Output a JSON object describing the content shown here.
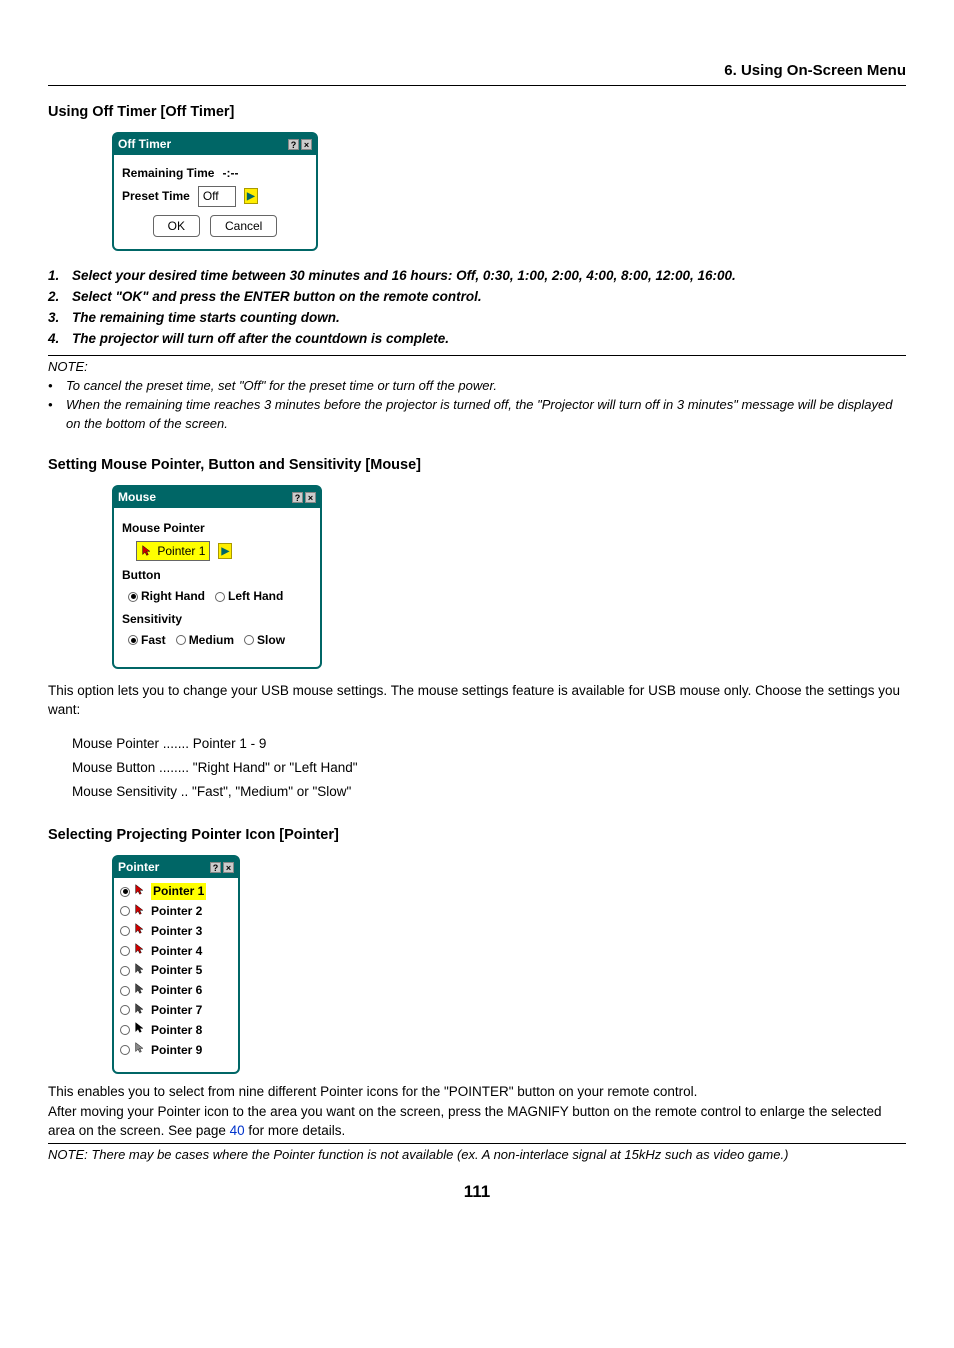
{
  "header": {
    "title": "6. Using On-Screen Menu"
  },
  "offTimer": {
    "sectionTitle": "Using Off Timer [Off Timer]",
    "dialogTitle": "Off Timer",
    "remainingLabel": "Remaining Time",
    "remainingValue": "-:--",
    "presetLabel": "Preset Time",
    "presetValue": "Off",
    "okLabel": "OK",
    "cancelLabel": "Cancel",
    "steps": [
      "Select your desired time between 30 minutes and 16 hours: Off, 0:30, 1:00, 2:00, 4:00, 8:00, 12:00, 16:00.",
      "Select \"OK\" and press the ENTER button on the remote control.",
      "The remaining time starts counting down.",
      "The projector will turn off after the countdown is complete."
    ],
    "noteLabel": "NOTE:",
    "notes": [
      "To cancel the preset time, set \"Off\" for the preset time or turn off the power.",
      "When the remaining time reaches 3 minutes before the projector is turned off, the \"Projector will turn off in 3 minutes\" message will be displayed on the bottom of the screen."
    ]
  },
  "mouse": {
    "sectionTitle": "Setting Mouse Pointer, Button and Sensitivity [Mouse]",
    "dialogTitle": "Mouse",
    "pointerLabel": "Mouse Pointer",
    "pointerValue": "Pointer 1",
    "buttonLabel": "Button",
    "buttonOpts": [
      "Right Hand",
      "Left Hand"
    ],
    "sensLabel": "Sensitivity",
    "sensOpts": [
      "Fast",
      "Medium",
      "Slow"
    ],
    "bodyText": "This option lets you to change your USB mouse settings. The mouse settings feature is available for USB mouse only. Choose the settings you want:",
    "settings": [
      {
        "k": "Mouse Pointer",
        "dots": ".......",
        "v": "Pointer 1 - 9"
      },
      {
        "k": "Mouse Button",
        "dots": "........",
        "v": "\"Right Hand\" or \"Left Hand\""
      },
      {
        "k": "Mouse Sensitivity",
        "dots": "..",
        "v": "\"Fast\", \"Medium\" or \"Slow\""
      }
    ]
  },
  "pointer": {
    "sectionTitle": "Selecting Projecting Pointer Icon [Pointer]",
    "dialogTitle": "Pointer",
    "items": [
      {
        "label": "Pointer 1",
        "selected": true,
        "color": "#cc0000"
      },
      {
        "label": "Pointer 2",
        "selected": false,
        "color": "#cc0000"
      },
      {
        "label": "Pointer 3",
        "selected": false,
        "color": "#cc0000"
      },
      {
        "label": "Pointer 4",
        "selected": false,
        "color": "#cc0000"
      },
      {
        "label": "Pointer 5",
        "selected": false,
        "color": "#444444"
      },
      {
        "label": "Pointer 6",
        "selected": false,
        "color": "#444444"
      },
      {
        "label": "Pointer 7",
        "selected": false,
        "color": "#444444"
      },
      {
        "label": "Pointer 8",
        "selected": false,
        "color": "#000000"
      },
      {
        "label": "Pointer 9",
        "selected": false,
        "color": "#888888"
      }
    ],
    "body1": "This enables you to select from nine different Pointer icons for the \"POINTER\" button on your remote control.",
    "body2a": "After moving your Pointer icon to the area you want on the screen, press the MAGNIFY button on the remote control to enlarge the selected area on the screen. See page ",
    "pageRef": "40",
    "body2b": " for more details.",
    "footnote": "NOTE: There may be cases where the Pointer function is not available (ex. A non-interlace signal at 15kHz such as video game.)"
  },
  "pageNumber": "111"
}
